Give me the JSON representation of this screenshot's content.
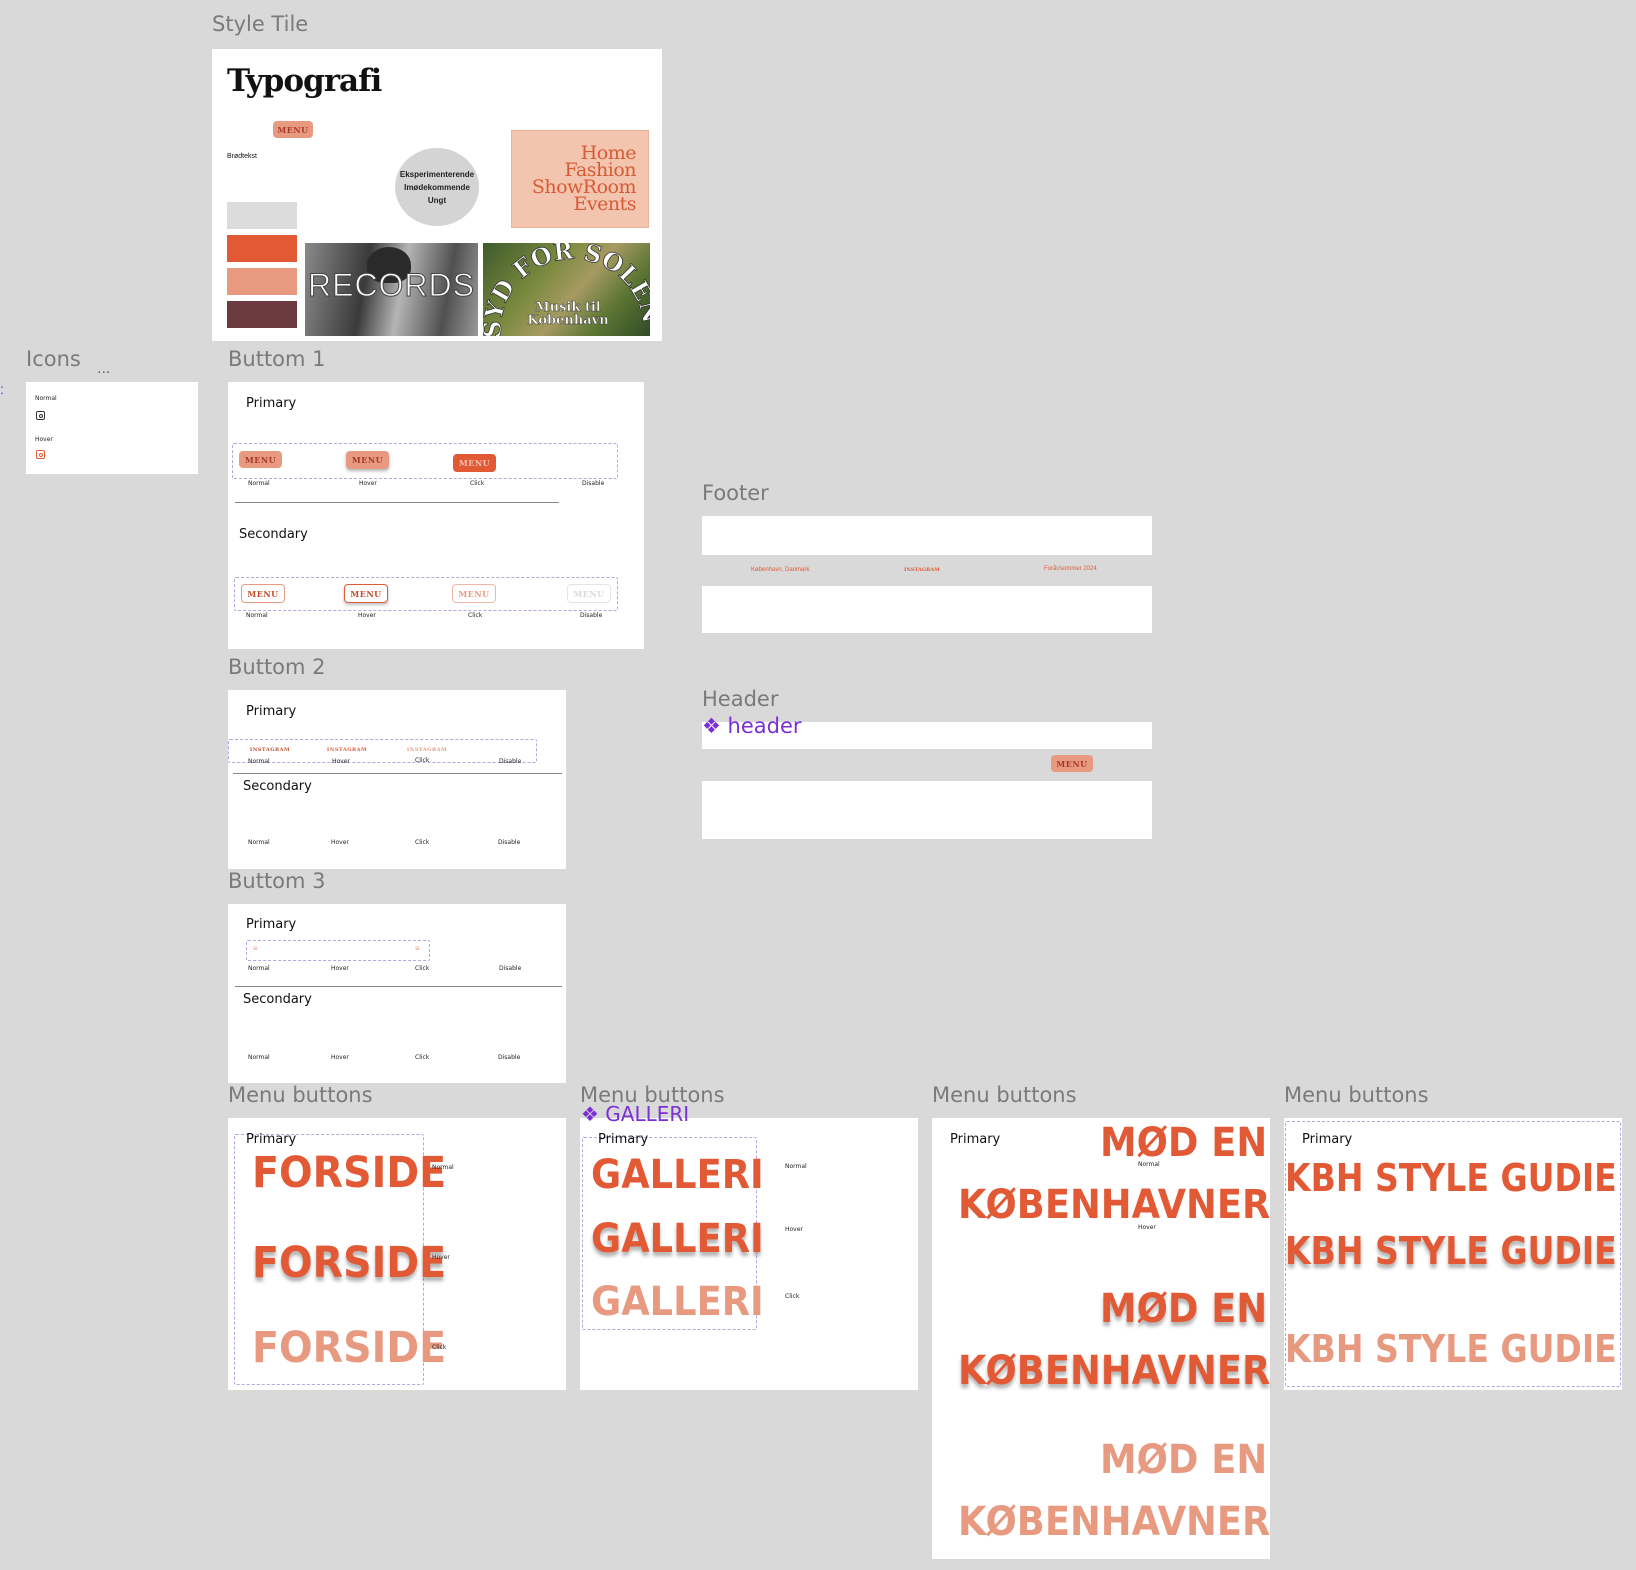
{
  "colors": {
    "orange": "#e25a35",
    "peach": "#e89a80",
    "pale_peach": "#f2c0ab",
    "light_grey": "#dcdcdc",
    "plum": "#6b3b40",
    "purple": "#7b2fd6"
  },
  "frame_titles": {
    "style_tile": "Style Tile",
    "icons": "Icons",
    "button1": "Buttom 1",
    "button2": "Buttom 2",
    "button3": "Buttom 3",
    "footer": "Footer",
    "header": "Header",
    "menu_buttons": "Menu buttons"
  },
  "style_tile": {
    "heading": "Typografi",
    "menu_label": "MENU",
    "body_text": "Brødtekst",
    "circle_lines": [
      "Eksperimenterende",
      "Imødekommende",
      "Ungt"
    ],
    "poster_lines": [
      "Home",
      "Fashion",
      "ShowRoom",
      "Events"
    ],
    "records_text": "RECORDS",
    "syd_arc": "SYD FOR SOLEN",
    "syd_sub": [
      "Musik til",
      "København"
    ]
  },
  "icons": {
    "ellipsis": "...",
    "normal": "Normal",
    "hover": "Hover",
    "icon_name": "instagram-icon"
  },
  "states": {
    "normal": "Normal",
    "hover": "Hover",
    "click": "Click",
    "disable": "Disable"
  },
  "sections": {
    "primary": "Primary",
    "secondary": "Secondary"
  },
  "button_labels": {
    "menu": "MENU",
    "instagram": "INSTAGRAM",
    "hamburger": "≡"
  },
  "footer": {
    "left": "København, Danmark",
    "center": "INSTAGRAM",
    "right": "Forår/sommer 2024"
  },
  "header": {
    "component_name": "header",
    "menu": "MENU"
  },
  "menu_frames": {
    "galleri_component": "GALLERI",
    "forside": "FORSIDE",
    "galleri": "GALLERI",
    "mod_en_line1": "MØD EN",
    "mod_en_line2": "KØBENHAVNER",
    "kbh": "KBH STYLE GUDIE"
  }
}
